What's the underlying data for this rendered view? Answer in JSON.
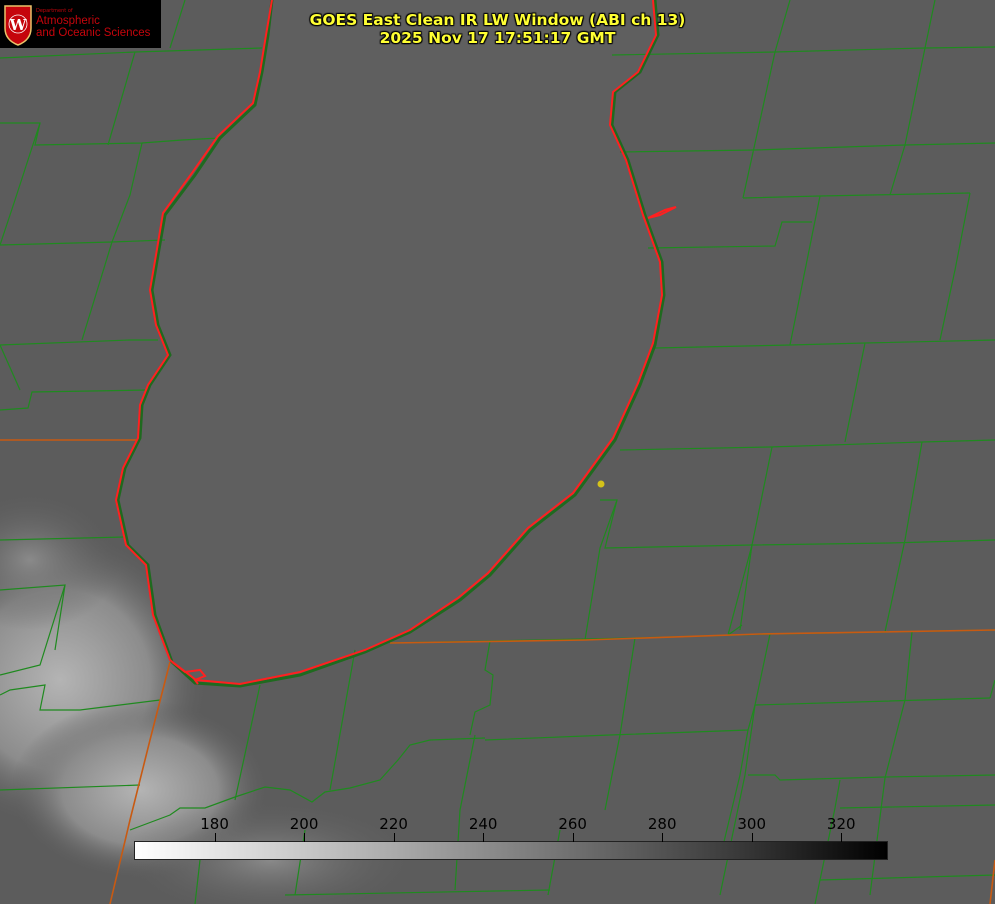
{
  "header": {
    "title_line1": "GOES East Clean IR LW Window (ABI ch 13)",
    "title_line2": "2025 Nov 17 17:51:17 GMT"
  },
  "logo": {
    "department": "Department of",
    "line1": "Atmospheric",
    "line2": "and Oceanic Sciences",
    "seal_letter": "W"
  },
  "colorbar": {
    "labels": [
      "180",
      "200",
      "220",
      "240",
      "260",
      "280",
      "300",
      "320"
    ],
    "range_min": 162,
    "range_max": 330
  },
  "colors": {
    "title": "#ffff33",
    "lake_outline": "#ff2020",
    "county_lines": "#1f8a1f",
    "state_line": "#c85a12",
    "marker": "#d4c21a",
    "logo_red": "#c5050c"
  }
}
